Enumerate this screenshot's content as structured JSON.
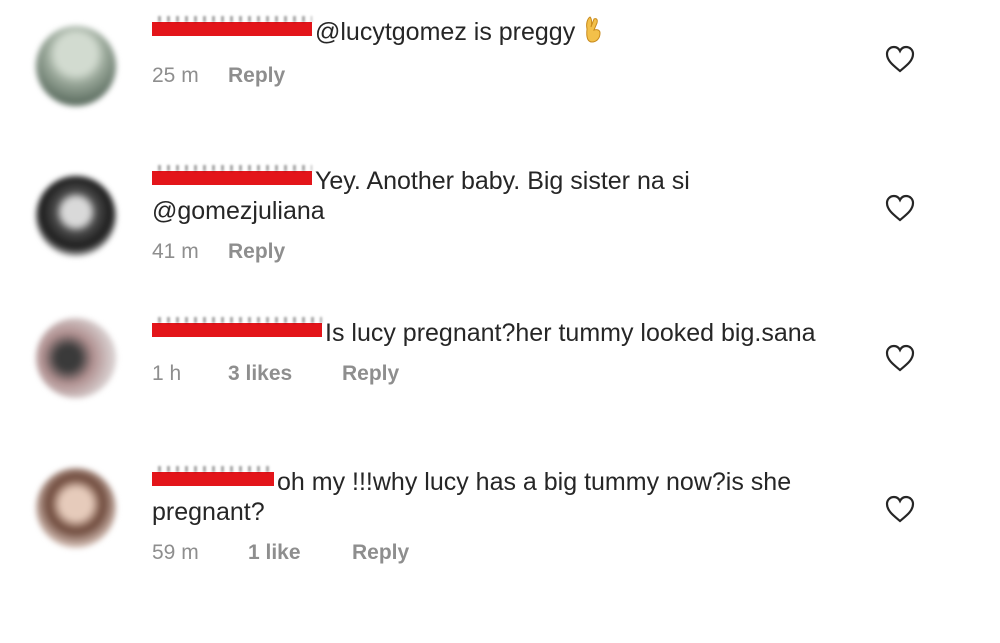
{
  "comments": [
    {
      "text": "@lucytgomez is preggy",
      "emoji": "crossed-fingers-icon",
      "time": "25 m",
      "likes": "",
      "reply": "Reply",
      "avatar_colors": [
        "#b8c4b8",
        "#7e8f7e",
        "#5c6f60"
      ]
    },
    {
      "text": "Yey. Another baby. Big sister na si @gomezjuliana",
      "time": "41 m",
      "likes": "",
      "reply": "Reply",
      "avatar_colors": [
        "#1c1c1c",
        "#d9d9d9",
        "#444444"
      ]
    },
    {
      "text": "Is lucy pregnant?her tummy looked big.sana",
      "time": "1 h",
      "likes": "3 likes",
      "reply": "Reply",
      "avatar_colors": [
        "#c9b9b9",
        "#3a3a3a",
        "#8c6b6b"
      ]
    },
    {
      "text": "oh my !!!why lucy has a big tummy now?is she pregnant?",
      "time": "59 m",
      "likes": "1 like",
      "reply": "Reply",
      "avatar_colors": [
        "#d8b8a8",
        "#5a3a30",
        "#e8d0c4"
      ]
    }
  ],
  "colors": {
    "redaction": "#e3151a",
    "text": "#262626",
    "meta": "#8e8e8e"
  }
}
